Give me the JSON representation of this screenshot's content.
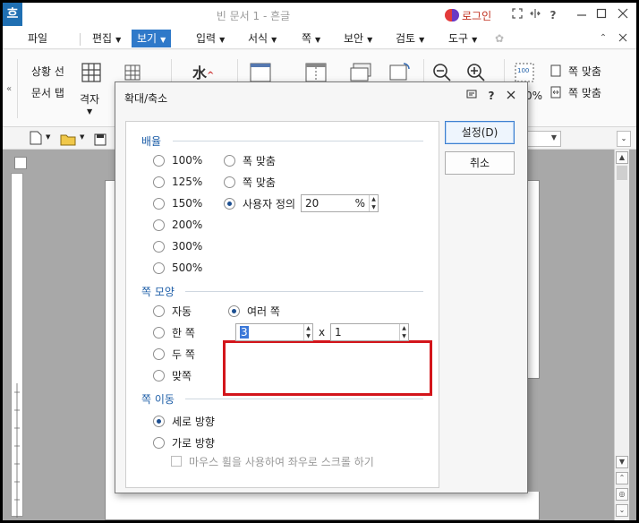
{
  "titlebar": {
    "logo": "흐",
    "title": "빈 문서 1 - 흔글",
    "login_label": "로그인",
    "icons": [
      "fullscreen-icon",
      "split-view-icon",
      "help-icon",
      "minimize-icon",
      "restore-icon",
      "close-icon"
    ],
    "help_glyph": "?"
  },
  "menubar": {
    "items": [
      {
        "label": "파일"
      },
      {
        "label": "편집"
      },
      {
        "label": "보기",
        "active": true
      },
      {
        "label": "입력"
      },
      {
        "label": "서식"
      },
      {
        "label": "쪽"
      },
      {
        "label": "보안"
      },
      {
        "label": "검토"
      },
      {
        "label": "도구"
      }
    ]
  },
  "ribbon": {
    "status_line": "상황 선",
    "doc_tab": "문서 탭",
    "grid": "격자",
    "fit_page_1": "쪽 맞춤",
    "fit_page_2": "쪽 맞춤",
    "zoom_partial": "0%",
    "zoom_icon_label": "100"
  },
  "dialog": {
    "title": "확대/축소",
    "sections": {
      "zoom": "배율",
      "page_shape": "쪽 모양",
      "page_move": "쪽 이동"
    },
    "zoom_options": [
      {
        "label": "100%",
        "selected": false
      },
      {
        "label": "125%",
        "selected": false
      },
      {
        "label": "150%",
        "selected": false
      },
      {
        "label": "200%",
        "selected": false
      },
      {
        "label": "300%",
        "selected": false
      },
      {
        "label": "500%",
        "selected": false
      }
    ],
    "fit_options": [
      {
        "label": "폭 맞춤",
        "selected": false
      },
      {
        "label": "쪽 맞춤",
        "selected": false
      },
      {
        "label": "사용자 정의",
        "selected": true
      }
    ],
    "custom_value": "20",
    "custom_unit": "%",
    "page_shape_options": [
      {
        "label": "자동",
        "selected": false
      },
      {
        "label": "한 쪽",
        "selected": false
      },
      {
        "label": "두 쪽",
        "selected": false
      },
      {
        "label": "맞쪽",
        "selected": false
      }
    ],
    "multi_page": {
      "label": "여러 쪽",
      "selected": true,
      "cols": "3",
      "times": "x",
      "rows": "1"
    },
    "move_options": [
      {
        "label": "세로 방향",
        "selected": true
      },
      {
        "label": "가로 방향",
        "selected": false
      }
    ],
    "mouse_wheel_option": {
      "label": "마우스 휠을 사용하여 좌우로 스크롤 하기",
      "checked": false,
      "disabled": true
    },
    "buttons": {
      "ok": "설정(D)",
      "cancel": "취소"
    }
  },
  "colors": {
    "accent": "#2f79c9",
    "section_heading": "#1f5fa8",
    "highlight_frame": "#d3151b"
  }
}
